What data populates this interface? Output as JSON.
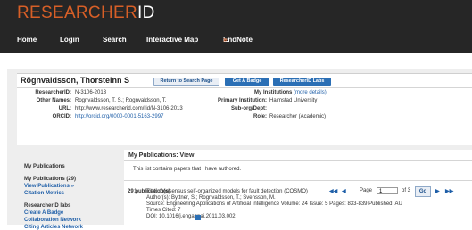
{
  "header": {
    "logo_primary": "RESEARCHER",
    "logo_secondary": "ID",
    "nav": [
      {
        "label": "Home"
      },
      {
        "label": "Login"
      },
      {
        "label": "Search"
      },
      {
        "label": "Interactive Map"
      },
      {
        "label": "EndNote",
        "suffix": "»"
      }
    ]
  },
  "profile": {
    "name": "Rögnvaldsson, Thorsteinn S",
    "buttons": {
      "return": "Return to Search Page",
      "badge": "Get A Badge",
      "labs": "ResearcherID Labs"
    },
    "left_rows": [
      {
        "label": "ResearcherID:",
        "value": "N-3106-2013"
      },
      {
        "label": "Other Names:",
        "value": "Rognvaldsson, T. S.; Rognvaldsson, T."
      },
      {
        "label": "URL:",
        "value": "http://www.researcherid.com/rid/N-3106-2013"
      },
      {
        "label": "ORCID:",
        "value": "http://orcid.org/0000-0001-5163-2997"
      }
    ],
    "my_institutions_label": "My Institutions",
    "more_details": "(more details)",
    "right_rows": [
      {
        "label": "Primary Institution:",
        "value": "Halmstad University"
      },
      {
        "label": "Sub-org/Dept:",
        "value": ""
      },
      {
        "label": "Role:",
        "value": "Researcher (Academic)"
      }
    ]
  },
  "sidebar": {
    "publications_heading": "My Publications",
    "publications_links": [
      "My Publications (29)",
      "View Publications »",
      "Citation Metrics"
    ],
    "labs_heading": "ResearcherID labs",
    "labs_links": [
      "Create A Badge",
      "Collaboration Network",
      "Citing Articles Network"
    ]
  },
  "main": {
    "title": "My Publications: View",
    "description": "This list contains papers that I have authored.",
    "count": "29 publication(s)",
    "pager": {
      "page_label": "Page",
      "page_value": "1",
      "of_label": "of 3",
      "go_label": "Go"
    },
    "publication": {
      "number": "1.",
      "title": "Title: Consensus self-organized models for fault detection (COSMO)",
      "authors": "Author(s): Byttner, S.; Rognvaldsson, T.; Svensson, M.",
      "source": "Source: Engineering Applications of Artificial Intelligence Volume: 24 Issue: 5 Pages: 833-839 Published: AU",
      "cited": "Times Cited: 7",
      "doi": "DOI: 10.1016/j.engappai.2011.03.002"
    }
  },
  "colors": {
    "header_bg": "#262626",
    "brand_orange": "#d75f27",
    "link_blue": "#1f5fa8",
    "button_blue": "#2b6fb5"
  }
}
